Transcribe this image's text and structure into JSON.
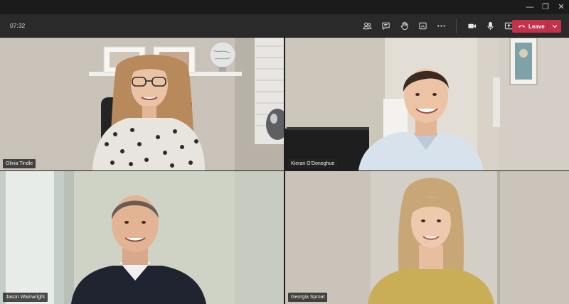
{
  "window": {
    "controls": [
      {
        "name": "minimize",
        "glyph": "—"
      },
      {
        "name": "restore",
        "glyph": "❐"
      },
      {
        "name": "close",
        "glyph": "✕"
      }
    ]
  },
  "toolbar": {
    "timer": "07:32",
    "icons": [
      "participants-icon",
      "chat-icon",
      "raise-hand-icon",
      "room-view-icon",
      "more-actions-icon",
      "camera-icon",
      "microphone-icon",
      "share-screen-icon"
    ],
    "leave": {
      "label": "Leave",
      "color": "#c4314b"
    }
  },
  "participants": [
    {
      "name": "Olivia Tindle"
    },
    {
      "name": "Kieran O'Donoghue"
    },
    {
      "name": "Jason Wainwright"
    },
    {
      "name": "Georgia Sproat"
    }
  ],
  "colors": {
    "toolbar_bg": "#2a2a2a",
    "titlebar_bg": "#1b1b1b",
    "name_tag_bg": "#232323"
  }
}
